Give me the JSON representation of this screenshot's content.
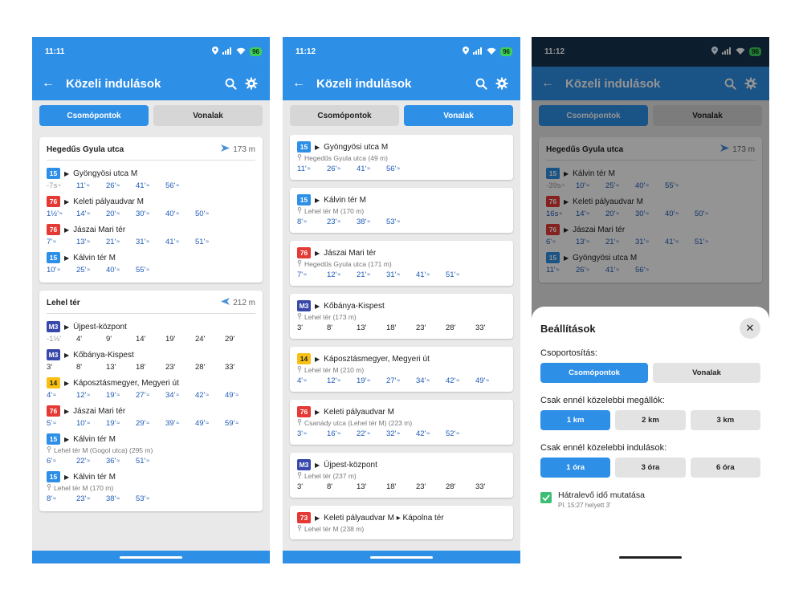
{
  "colors": {
    "blue": "#2e8fe7",
    "red": "#e53935",
    "m3": "#3949ab",
    "yellow": "#f9c013",
    "green": "#3cbf74"
  },
  "phones": [
    {
      "time": "11:11",
      "battery": "96",
      "title": "Közeli indulások",
      "seg": [
        "Csomópontok",
        "Vonalak"
      ],
      "cards": [
        {
          "stop": "Hegedűs Gyula utca",
          "dist": "173 m",
          "routes": [
            {
              "badge": "15",
              "dest": "Gyöngyösi utca M",
              "times": [
                "-7s",
                "11'",
                "26'",
                "41'",
                "56'"
              ]
            },
            {
              "badge": "76",
              "dest": "Keleti pályaudvar M",
              "times": [
                "1½'",
                "14'",
                "20'",
                "30'",
                "40'",
                "50'"
              ]
            },
            {
              "badge": "76",
              "dest": "Jászai Mari tér",
              "times": [
                "7'",
                "13'",
                "21'",
                "31'",
                "41'",
                "51'"
              ]
            },
            {
              "badge": "15",
              "dest": "Kálvin tér M",
              "times": [
                "10'",
                "25'",
                "40'",
                "55'"
              ]
            }
          ]
        },
        {
          "stop": "Lehel tér",
          "dist": "212 m",
          "routes": [
            {
              "badge": "M3",
              "dest": "Újpest-központ",
              "times": [
                "-1½'",
                "4'",
                "9'",
                "14'",
                "19'",
                "24'",
                "29'"
              ]
            },
            {
              "badge": "M3",
              "dest": "Kőbánya-Kispest",
              "times": [
                "3'",
                "8'",
                "13'",
                "18'",
                "23'",
                "28'",
                "33'"
              ]
            },
            {
              "badge": "14",
              "dest": "Káposztásmegyer, Megyeri út",
              "times": [
                "4'",
                "12'",
                "19'",
                "27'",
                "34'",
                "42'",
                "49'"
              ]
            },
            {
              "badge": "76",
              "dest": "Jászai Mari tér",
              "times": [
                "5'",
                "10'",
                "19'",
                "29'",
                "39'",
                "49'",
                "59'"
              ]
            },
            {
              "badge": "15",
              "dest": "Kálvin tér M",
              "loc": "Lehel tér M (Gogol utca) (295 m)",
              "times": [
                "6'",
                "22'",
                "36'",
                "51'"
              ]
            },
            {
              "badge": "15",
              "dest": "Kálvin tér M",
              "loc": "Lehel tér M (170 m)",
              "times": [
                "8'",
                "23'",
                "38'",
                "53'"
              ]
            }
          ]
        }
      ]
    },
    {
      "time": "11:12",
      "battery": "96",
      "title": "Közeli indulások",
      "seg": [
        "Csomópontok",
        "Vonalak"
      ],
      "cards": [
        {
          "routes": [
            {
              "badge": "15",
              "dest": "Gyöngyösi utca M",
              "loc": "Hegedűs Gyula utca (49 m)",
              "times": [
                "11'",
                "26'",
                "41'",
                "56'"
              ]
            }
          ]
        },
        {
          "routes": [
            {
              "badge": "15",
              "dest": "Kálvin tér M",
              "loc": "Lehel tér M (170 m)",
              "times": [
                "8'",
                "23'",
                "38'",
                "53'"
              ]
            }
          ]
        },
        {
          "routes": [
            {
              "badge": "76",
              "dest": "Jászai Mari tér",
              "loc": "Hegedűs Gyula utca (171 m)",
              "times": [
                "7'",
                "12'",
                "21'",
                "31'",
                "41'",
                "51'"
              ]
            }
          ]
        },
        {
          "routes": [
            {
              "badge": "M3",
              "dest": "Kőbánya-Kispest",
              "loc": "Lehel tér (173 m)",
              "times": [
                "3'",
                "8'",
                "13'",
                "18'",
                "23'",
                "28'",
                "33'"
              ]
            }
          ]
        },
        {
          "routes": [
            {
              "badge": "14",
              "dest": "Káposztásmegyer, Megyeri út",
              "loc": "Lehel tér M (210 m)",
              "times": [
                "4'",
                "12'",
                "19'",
                "27'",
                "34'",
                "42'",
                "49'"
              ]
            }
          ]
        },
        {
          "routes": [
            {
              "badge": "76",
              "dest": "Keleti pályaudvar M",
              "loc": "Csanády utca (Lehel tér M) (223 m)",
              "times": [
                "3'",
                "16'",
                "22'",
                "32'",
                "42'",
                "52'"
              ]
            }
          ]
        },
        {
          "routes": [
            {
              "badge": "M3",
              "dest": "Újpest-központ",
              "loc": "Lehel tér (237 m)",
              "times": [
                "3'",
                "8'",
                "13'",
                "18'",
                "23'",
                "28'",
                "33'"
              ]
            }
          ]
        },
        {
          "routes": [
            {
              "badge": "73",
              "dest": "Keleti pályaudvar M ▸ Kápolna tér",
              "loc": "Lehel tér M (238 m)",
              "times": []
            }
          ]
        }
      ]
    },
    {
      "time": "11:12",
      "battery": "96",
      "title": "Közeli indulások",
      "seg": [
        "Csomópontok",
        "Vonalak"
      ],
      "cards": [
        {
          "stop": "Hegedűs Gyula utca",
          "dist": "173 m",
          "routes": [
            {
              "badge": "15",
              "dest": "Kálvin tér M",
              "times": [
                "-39s",
                "10'",
                "25'",
                "40'",
                "55'"
              ]
            },
            {
              "badge": "76",
              "dest": "Keleti pályaudvar M",
              "times": [
                "16s",
                "14'",
                "20'",
                "30'",
                "40'",
                "50'"
              ]
            },
            {
              "badge": "76",
              "dest": "Jászai Mari tér",
              "times": [
                "6'",
                "13'",
                "21'",
                "31'",
                "41'",
                "51'"
              ]
            },
            {
              "badge": "15",
              "dest": "Gyöngyösi utca M",
              "times": [
                "11'",
                "26'",
                "41'",
                "56'"
              ]
            }
          ]
        }
      ],
      "sheet": {
        "title": "Beállítások",
        "group_label": "Csoportosítás:",
        "group_opts": [
          "Csomópontok",
          "Vonalak"
        ],
        "stops_label": "Csak ennél közelebbi megállók:",
        "stops_opts": [
          "1 km",
          "2 km",
          "3 km"
        ],
        "deps_label": "Csak ennél közelebbi indulások:",
        "deps_opts": [
          "1 óra",
          "3 óra",
          "6 óra"
        ],
        "check_label": "Hátralevő idő mutatása",
        "check_sub": "Pl. 15:27 helyett 3'"
      }
    }
  ]
}
